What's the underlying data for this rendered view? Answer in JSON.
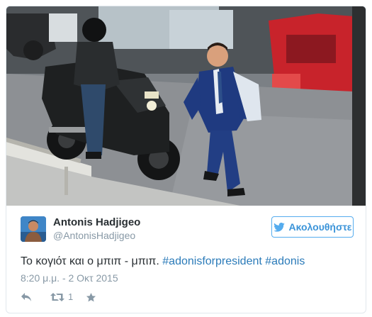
{
  "tweet": {
    "author": {
      "display_name": "Antonis Hadjigeo",
      "handle": "@AntonisHadjigeo",
      "avatar_icon": "profile-avatar"
    },
    "follow_button": {
      "label": "Ακολουθήστε",
      "icon": "twitter-bird-icon",
      "color": "#55acee"
    },
    "text": {
      "plain": "Το κογιότ και ο μπιπ - μπιπ.",
      "hashtags": [
        "#adonisforpresident",
        "#adonis"
      ]
    },
    "timestamp": "8:20 μ.μ. - 2 Οκτ 2015",
    "actions": {
      "reply_icon": "reply-icon",
      "retweet_icon": "retweet-icon",
      "retweet_count": "1",
      "like_icon": "star-icon"
    },
    "colors": {
      "link": "#2b7bb9",
      "muted": "#8899a6",
      "text": "#292f33"
    }
  }
}
